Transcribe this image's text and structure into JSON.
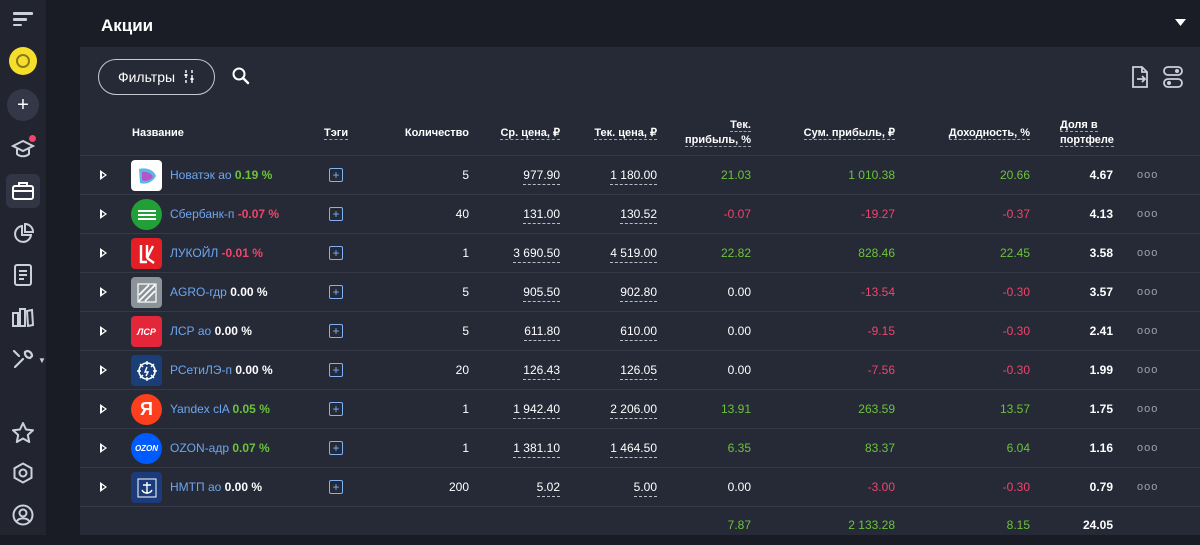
{
  "header": {
    "title": "Акции"
  },
  "toolbar": {
    "filters_label": "Фильтры"
  },
  "columns": {
    "name": "Название",
    "tags": "Тэги",
    "qty": "Количество",
    "avg": "Ср. цена, ₽",
    "cur": "Тек. цена, ₽",
    "tp1": "Тек.",
    "tp2": "прибыль, %",
    "sum": "Сум. прибыль, ₽",
    "yield": "Доходность, %",
    "share1": "Доля в",
    "share2": "портфеле"
  },
  "rows": [
    {
      "name": "Новатэк ао",
      "pct": "0.19 %",
      "pct_sign": "pos",
      "qty": "5",
      "avg": "977.90",
      "cur": "1 180.00",
      "tp": "21.03",
      "tp_sign": "pos",
      "sum": "1 010.38",
      "sum_sign": "pos",
      "yield": "20.66",
      "yield_sign": "pos",
      "share": "4.67",
      "logo": "novatek"
    },
    {
      "name": "Сбербанк-п",
      "pct": "-0.07 %",
      "pct_sign": "neg",
      "qty": "40",
      "avg": "131.00",
      "cur": "130.52",
      "tp": "-0.07",
      "tp_sign": "neg",
      "sum": "-19.27",
      "sum_sign": "neg",
      "yield": "-0.37",
      "yield_sign": "neg",
      "share": "4.13",
      "logo": "sber"
    },
    {
      "name": "ЛУКОЙЛ",
      "pct": "-0.01 %",
      "pct_sign": "neg",
      "qty": "1",
      "avg": "3 690.50",
      "cur": "4 519.00",
      "tp": "22.82",
      "tp_sign": "pos",
      "sum": "828.46",
      "sum_sign": "pos",
      "yield": "22.45",
      "yield_sign": "pos",
      "share": "3.58",
      "logo": "lukoil"
    },
    {
      "name": "AGRO-гдр",
      "pct": "0.00 %",
      "pct_sign": "zero",
      "qty": "5",
      "avg": "905.50",
      "cur": "902.80",
      "tp": "0.00",
      "tp_sign": "zero",
      "sum": "-13.54",
      "sum_sign": "neg",
      "yield": "-0.30",
      "yield_sign": "neg",
      "share": "3.57",
      "logo": "agro"
    },
    {
      "name": "ЛСР ао",
      "pct": "0.00 %",
      "pct_sign": "zero",
      "qty": "5",
      "avg": "611.80",
      "cur": "610.00",
      "tp": "0.00",
      "tp_sign": "zero",
      "sum": "-9.15",
      "sum_sign": "neg",
      "yield": "-0.30",
      "yield_sign": "neg",
      "share": "2.41",
      "logo": "lsr"
    },
    {
      "name": "РСетиЛЭ-п",
      "pct": "0.00 %",
      "pct_sign": "zero",
      "qty": "20",
      "avg": "126.43",
      "cur": "126.05",
      "tp": "0.00",
      "tp_sign": "zero",
      "sum": "-7.56",
      "sum_sign": "neg",
      "yield": "-0.30",
      "yield_sign": "neg",
      "share": "1.99",
      "logo": "rseti"
    },
    {
      "name": "Yandex clA",
      "pct": "0.05 %",
      "pct_sign": "pos",
      "qty": "1",
      "avg": "1 942.40",
      "cur": "2 206.00",
      "tp": "13.91",
      "tp_sign": "pos",
      "sum": "263.59",
      "sum_sign": "pos",
      "yield": "13.57",
      "yield_sign": "pos",
      "share": "1.75",
      "logo": "yandex"
    },
    {
      "name": "OZON-адр",
      "pct": "0.07 %",
      "pct_sign": "pos",
      "qty": "1",
      "avg": "1 381.10",
      "cur": "1 464.50",
      "tp": "6.35",
      "tp_sign": "pos",
      "sum": "83.37",
      "sum_sign": "pos",
      "yield": "6.04",
      "yield_sign": "pos",
      "share": "1.16",
      "logo": "ozon"
    },
    {
      "name": "НМТП ао",
      "pct": "0.00 %",
      "pct_sign": "zero",
      "qty": "200",
      "avg": "5.02",
      "cur": "5.00",
      "tp": "0.00",
      "tp_sign": "zero",
      "sum": "-3.00",
      "sum_sign": "neg",
      "yield": "-0.30",
      "yield_sign": "neg",
      "share": "0.79",
      "logo": "nmtp"
    }
  ],
  "totals": {
    "tp": "7.87",
    "sum": "2 133.28",
    "yield": "8.15",
    "share": "24.05"
  },
  "logo_text": {
    "lsr": "ЛСР",
    "yandex": "Я",
    "ozon": "OZON"
  },
  "row_actions_label": "ooo",
  "colors": {
    "positive": "#6bc33a",
    "negative": "#f0446a",
    "link": "#6ea6ef",
    "background": "#262a37",
    "header": "#1b1d26",
    "sidebar": "#22252f"
  },
  "icons": {
    "sidebar": [
      "menu-icon",
      "avatar-icon",
      "plus-icon",
      "education-icon",
      "portfolio-icon",
      "pie-chart-icon",
      "document-icon",
      "books-icon",
      "tools-icon",
      "star-icon",
      "hexagon-icon",
      "profile-icon"
    ],
    "toolbar": [
      "sliders-icon",
      "search-icon",
      "export-icon",
      "toggle-settings-icon"
    ]
  }
}
